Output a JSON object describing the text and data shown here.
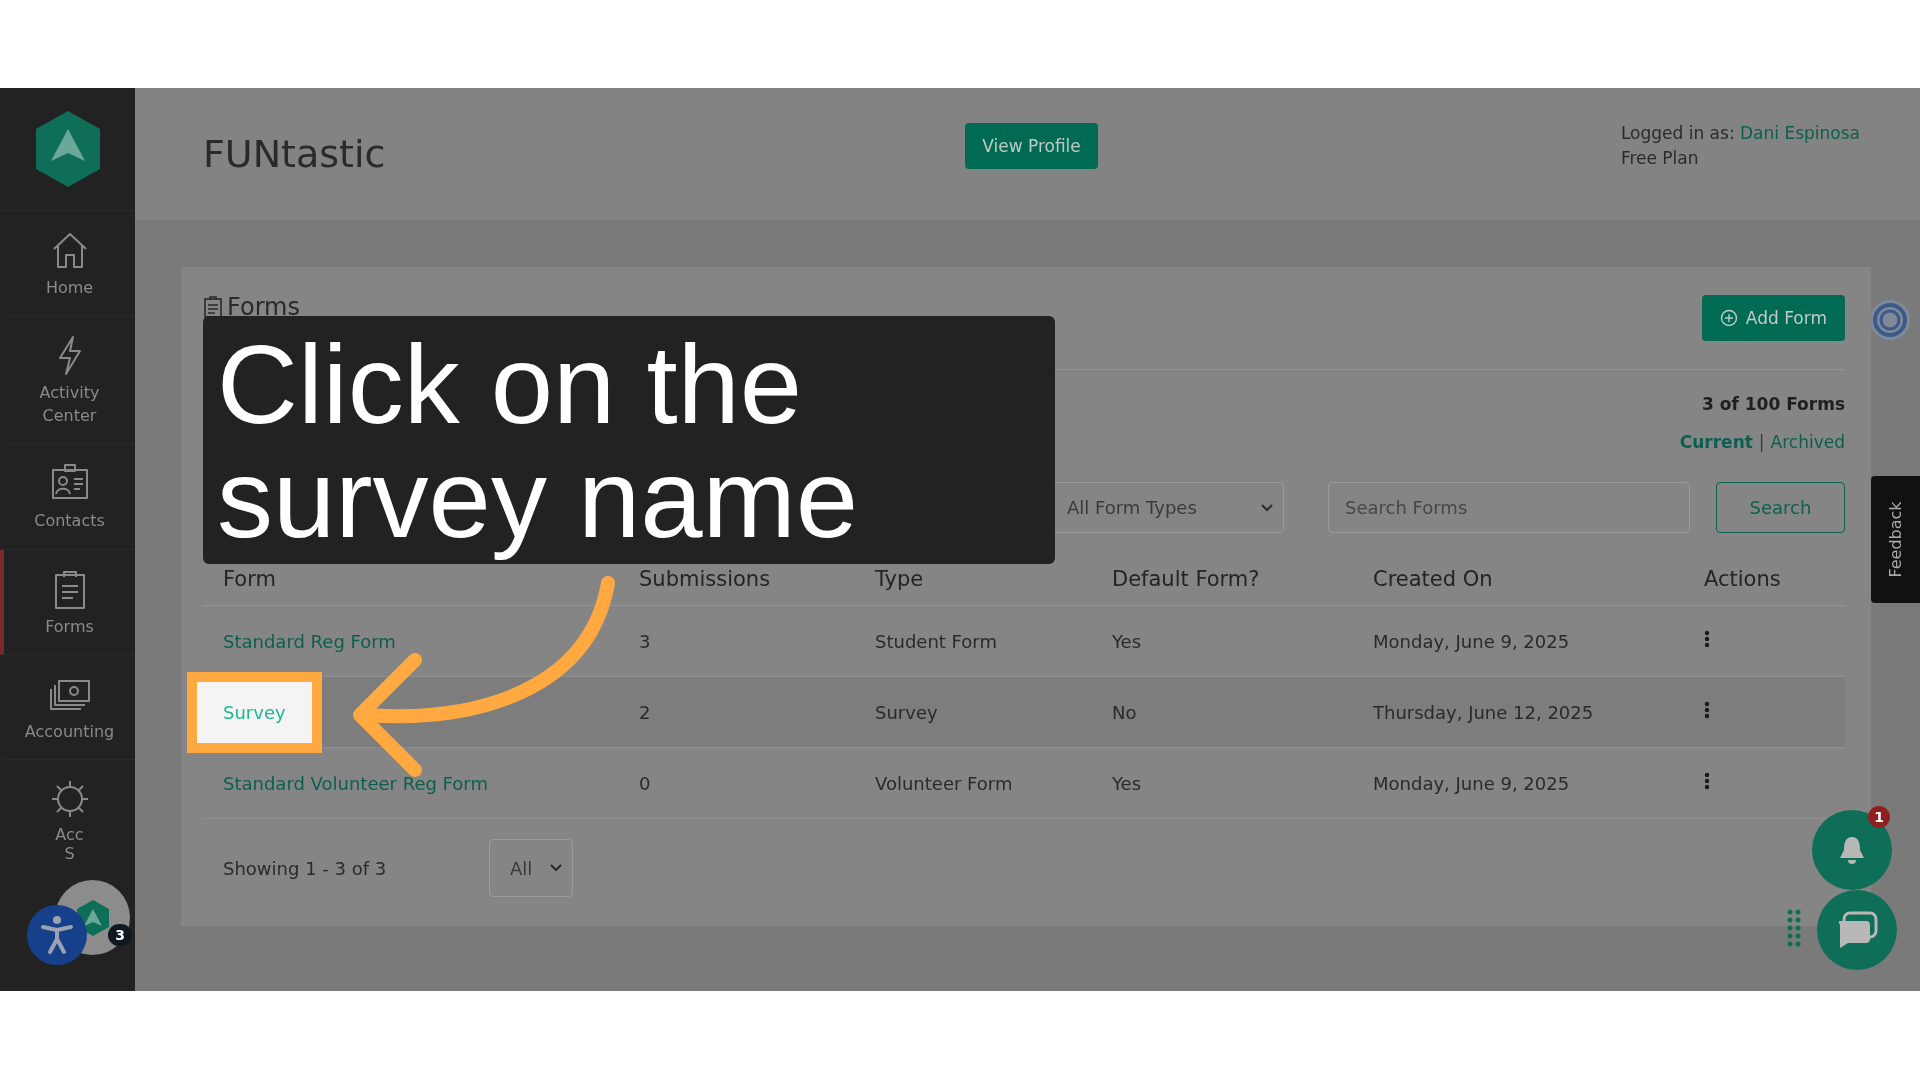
{
  "app": {
    "title": "FUNtastic",
    "view_profile": "View Profile",
    "logged_in_label": "Logged in as:",
    "user_name": "Dani Espinosa",
    "plan": "Free Plan"
  },
  "sidebar": {
    "items": [
      {
        "kind": "home",
        "label_lines": [
          "Home"
        ],
        "selected": false
      },
      {
        "kind": "activity",
        "label_lines": [
          "Activity",
          "Center"
        ],
        "selected": false
      },
      {
        "kind": "contacts",
        "label_lines": [
          "Contacts"
        ],
        "selected": false
      },
      {
        "kind": "forms",
        "label_lines": [
          "Forms"
        ],
        "selected": true
      },
      {
        "kind": "accounting",
        "label_lines": [
          "Accounting"
        ],
        "selected": false
      },
      {
        "kind": "settings",
        "label_lines": [
          "Acc",
          "S"
        ],
        "selected": false
      }
    ]
  },
  "forms_card": {
    "title": "Forms",
    "add_button": "Add Form",
    "count": "3 of 100 Forms",
    "views": [
      {
        "label": "Current",
        "selected": true
      },
      {
        "label": "Archived",
        "selected": false
      }
    ],
    "views_separator": "|",
    "type_filter": "All Form Types",
    "search_placeholder": "Search Forms",
    "search_button": "Search"
  },
  "table": {
    "columns": [
      "Form",
      "Submissions",
      "Type",
      "Default Form?",
      "Created On",
      "Actions"
    ],
    "rows": [
      {
        "form": "Standard Reg Form",
        "submissions": "3",
        "type": "Student Form",
        "default": "Yes",
        "created": "Monday, June 9, 2025",
        "highlighted": false
      },
      {
        "form": "Survey",
        "submissions": "2",
        "type": "Survey",
        "default": "No",
        "created": "Thursday, June 12, 2025",
        "highlighted": true
      },
      {
        "form": "Standard Volunteer Reg Form",
        "submissions": "0",
        "type": "Volunteer Form",
        "default": "Yes",
        "created": "Monday, June 9, 2025",
        "highlighted": false
      }
    ]
  },
  "pagination": {
    "text": "Showing 1 - 3 of 3",
    "page_size": "All"
  },
  "feedback": "Feedback",
  "widgets": {
    "notification_count": "1",
    "app_badge": "3"
  },
  "callout": {
    "text": "Click on the survey name"
  }
}
